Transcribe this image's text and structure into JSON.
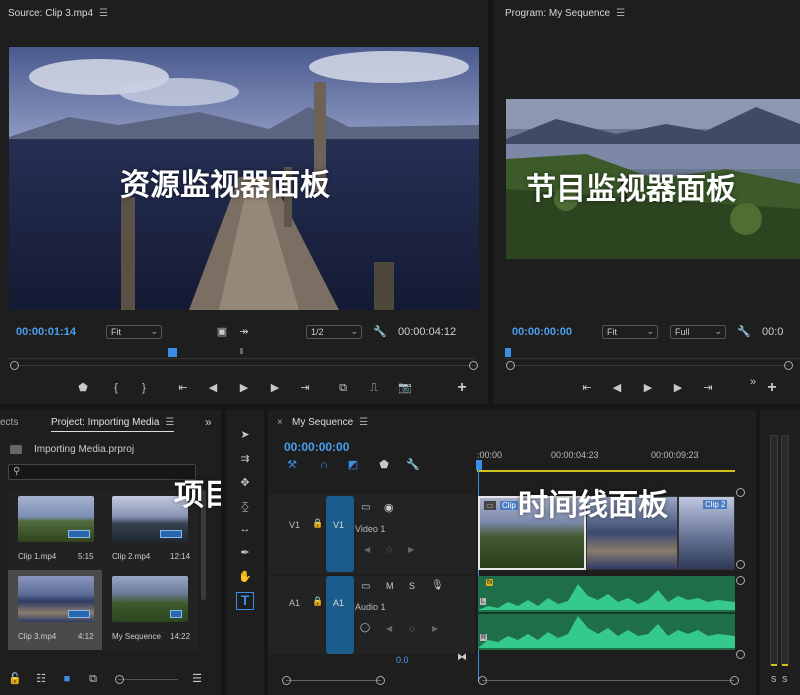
{
  "source": {
    "title": "Source: Clip 3.mp4",
    "timecode_in": "00:00:01:14",
    "fit": "Fit",
    "resolution": "1/2",
    "timecode_out": "00:00:04:12",
    "overlay": "资源监视器面板"
  },
  "program": {
    "title": "Program: My Sequence",
    "timecode": "00:00:00:00",
    "fit": "Fit",
    "quality": "Full",
    "timecode_right": "00:0",
    "overlay": "节目监视器面板"
  },
  "project": {
    "tab_prev": "ects",
    "title": "Project: Importing Media",
    "file": "Importing Media.prproj",
    "overlay": "项目面板",
    "items": [
      {
        "name": "Clip 1.mp4",
        "dur": "5:15"
      },
      {
        "name": "Clip 2.mp4",
        "dur": "12:14"
      },
      {
        "name": "Clip 3.mp4",
        "dur": "4:12"
      },
      {
        "name": "My Sequence",
        "dur": "14:22"
      }
    ]
  },
  "timeline": {
    "title": "My Sequence",
    "timecode": "00:00:00:00",
    "overlay": "时间线面板",
    "ruler": [
      ":00:00",
      "00:00:04:23",
      "00:00:09:23"
    ],
    "v1": "V1",
    "v1_target": "V1",
    "video_name": "Video 1",
    "a1": "A1",
    "a1_target": "A1",
    "audio_name": "Audio 1",
    "clip_a": "Clip",
    "clip_b": "Clip 2",
    "m": "M",
    "s": "S",
    "volume": "0.0",
    "fx": "fx",
    "L": "L",
    "R": "R"
  },
  "meter": {
    "s1": "S",
    "s2": "S"
  },
  "colors": {
    "accent": "#4a9ff0",
    "audio_green": "#2ec48a",
    "track_blue": "#1a5c8c",
    "playhead": "#3a8ee6"
  }
}
